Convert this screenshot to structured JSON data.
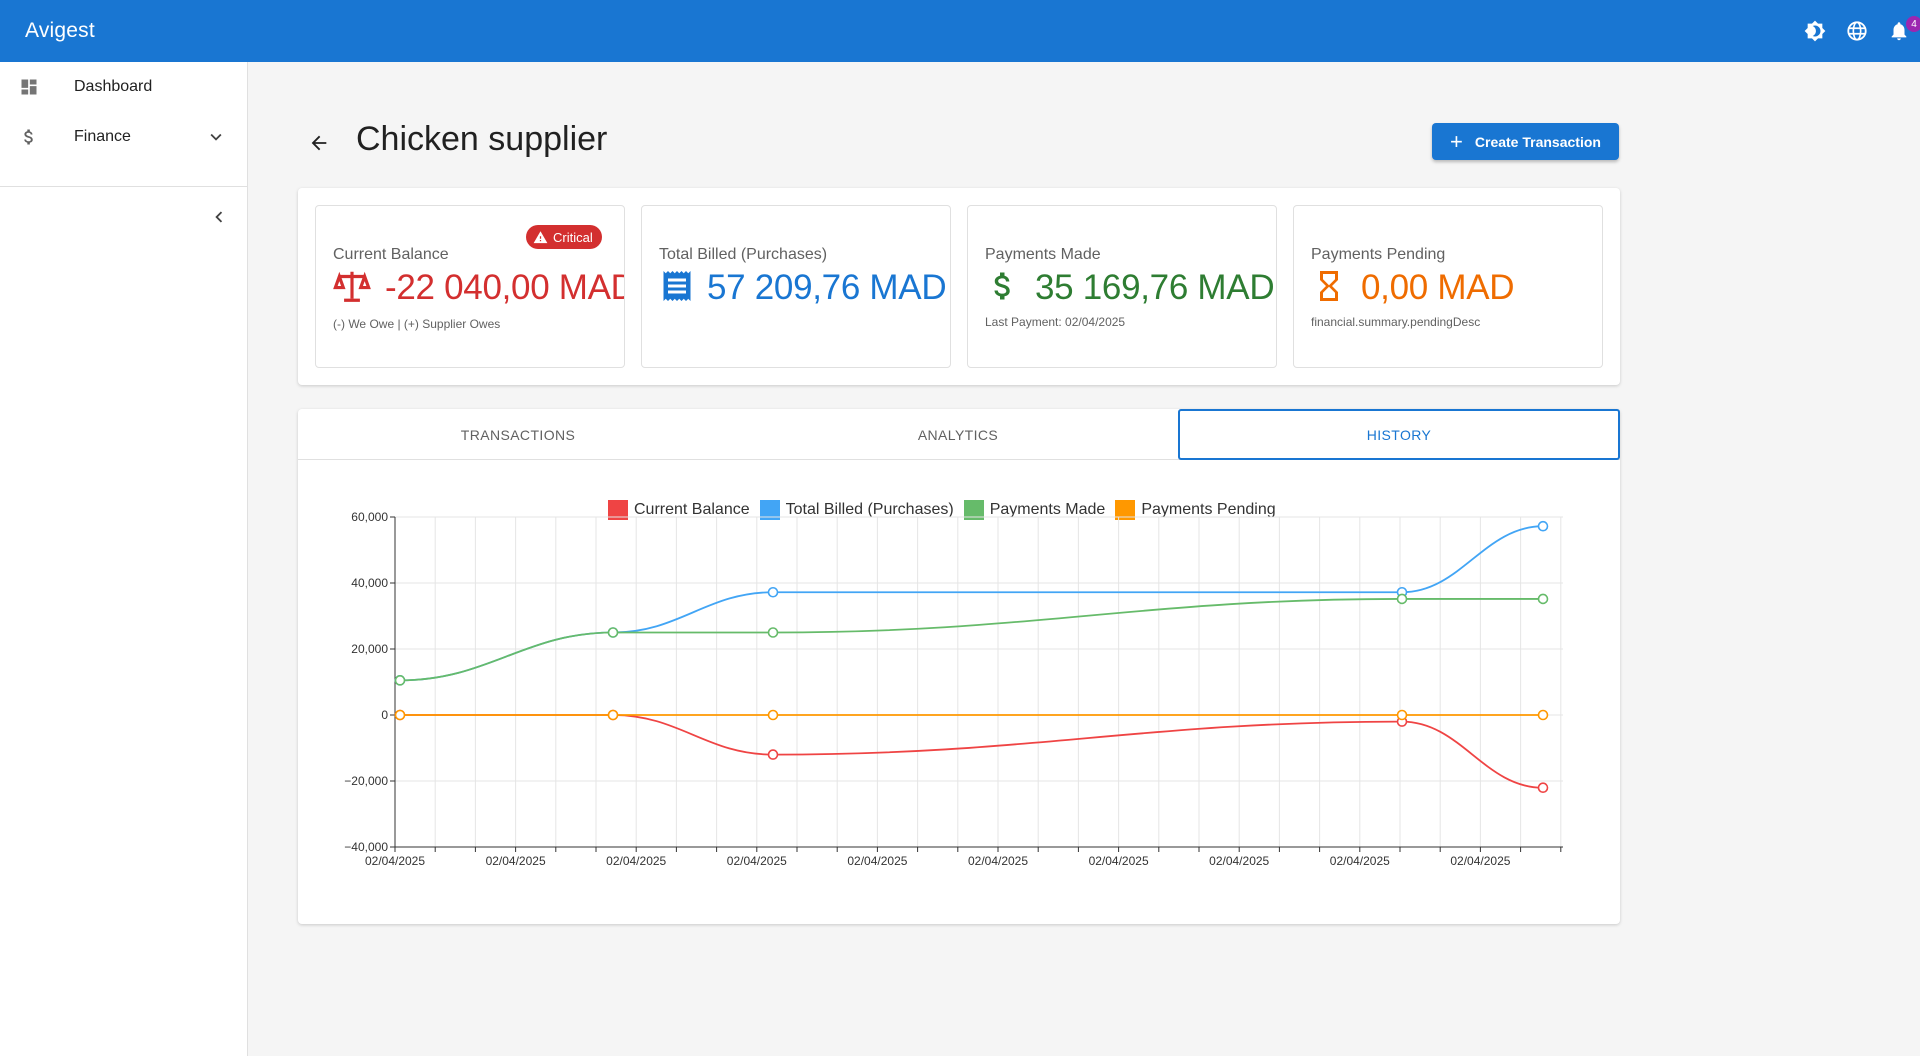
{
  "app": {
    "title": "Avigest",
    "notification_count": "4"
  },
  "appbar_icons": [
    "brightness-icon",
    "language-icon",
    "notifications-icon"
  ],
  "sidebar": {
    "items": [
      {
        "label": "Dashboard",
        "icon": "dashboard-icon"
      },
      {
        "label": "Finance",
        "icon": "dollar-icon",
        "expandable": true
      }
    ]
  },
  "page": {
    "title": "Chicken supplier",
    "create_label": "Create Transaction"
  },
  "summary": {
    "current_balance": {
      "title": "Current Balance",
      "badge": "Critical",
      "value": "-22 040,00 MAD",
      "note": "(-) We Owe | (+) Supplier Owes",
      "color": "#d32f2f",
      "icon": "balance-scale-icon"
    },
    "total_billed": {
      "title": "Total Billed (Purchases)",
      "value": "57 209,76 MAD",
      "color": "#1976d2",
      "icon": "receipt-icon"
    },
    "payments_made": {
      "title": "Payments Made",
      "value": "35 169,76 MAD",
      "note": "Last Payment: 02/04/2025",
      "color": "#2e7d32",
      "icon": "dollar-icon"
    },
    "payments_pending": {
      "title": "Payments Pending",
      "value": "0,00 MAD",
      "note": "financial.summary.pendingDesc",
      "color": "#ef6c00",
      "icon": "hourglass-icon"
    }
  },
  "tabs": [
    {
      "label": "TRANSACTIONS",
      "active": false
    },
    {
      "label": "ANALYTICS",
      "active": false
    },
    {
      "label": "HISTORY",
      "active": true
    }
  ],
  "chart_data": {
    "type": "line",
    "x": [
      "02/04/2025",
      "02/04/2025",
      "02/04/2025",
      "02/04/2025",
      "02/04/2025",
      "02/04/2025"
    ],
    "x_tick_labels": [
      "02/04/2025",
      "02/04/2025",
      "02/04/2025",
      "02/04/2025",
      "02/04/2025",
      "02/04/2025",
      "02/04/2025",
      "02/04/2025",
      "02/04/2025",
      "02/04/2025"
    ],
    "y_ticks": [
      -40000,
      -20000,
      0,
      20000,
      40000,
      60000
    ],
    "y_tick_labels": [
      "−40,000",
      "−20,000",
      "0",
      "20,000",
      "40,000",
      "60,000"
    ],
    "ylim": [
      -40000,
      60000
    ],
    "grid": true,
    "legend_position": "top",
    "series": [
      {
        "name": "Current Balance",
        "color": "#ef4444",
        "values": [
          0,
          0,
          -12000,
          -2000,
          -22040
        ]
      },
      {
        "name": "Total Billed (Purchases)",
        "color": "#42a5f5",
        "values": [
          10500,
          25000,
          37200,
          37200,
          57210
        ]
      },
      {
        "name": "Payments Made",
        "color": "#66bb6a",
        "values": [
          10500,
          25000,
          25000,
          35170,
          35170
        ]
      },
      {
        "name": "Payments Pending",
        "color": "#ff9800",
        "values": [
          0,
          0,
          0,
          0,
          0
        ]
      }
    ]
  }
}
